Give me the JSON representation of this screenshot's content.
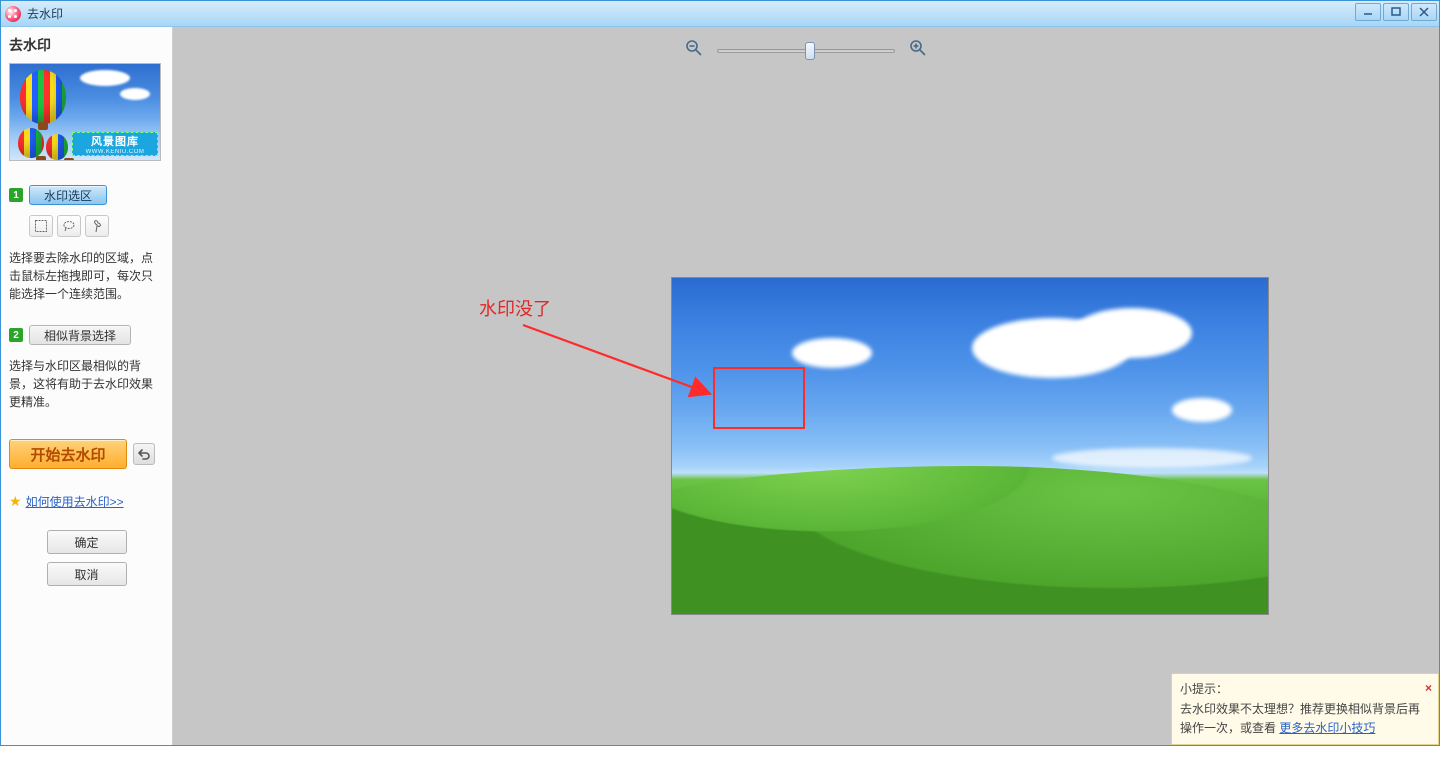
{
  "window": {
    "title": "去水印"
  },
  "sidebar": {
    "heading": "去水印",
    "thumb_watermark_line1": "风景图库",
    "thumb_watermark_line2": "WWW.KENIU.COM",
    "step1": {
      "num": "1",
      "button": "水印选区",
      "desc": "选择要去除水印的区域，点击鼠标左拖拽即可，每次只能选择一个连续范围。"
    },
    "step2": {
      "num": "2",
      "button": "相似背景选择",
      "desc": "选择与水印区最相似的背景，这将有助于去水印效果更精准。"
    },
    "start_button": "开始去水印",
    "help_link": "如何使用去水印>>",
    "ok_button": "确定",
    "cancel_button": "取消"
  },
  "canvas": {
    "annotation": "水印没了"
  },
  "tip": {
    "title": "小提示：",
    "body_a": "去水印效果不太理想？推荐更换相似背景后再操作一次，",
    "body_b": "或查看 ",
    "link": "更多去水印小技巧"
  }
}
